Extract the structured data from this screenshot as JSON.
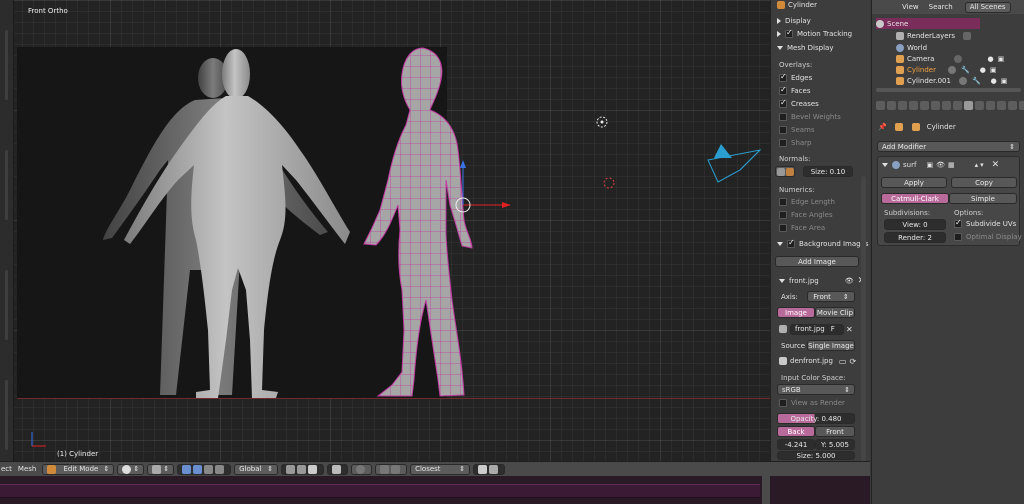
{
  "viewport": {
    "view_label": "Front Ortho",
    "active_object_label": "(1) Cylinder"
  },
  "npanel": {
    "object_field": "Cylinder",
    "display": "Display",
    "motion_tracking": "Motion Tracking",
    "mesh_display": "Mesh Display",
    "overlays": "Overlays:",
    "edges": "Edges",
    "faces": "Faces",
    "creases": "Creases",
    "bevel_weights": "Bevel Weights",
    "seams": "Seams",
    "sharp": "Sharp",
    "normals": "Normals:",
    "normal_size": "Size: 0.10",
    "numerics": "Numerics:",
    "edge_length": "Edge Length",
    "face_angles": "Face Angles",
    "face_area": "Face Area",
    "background_images": "Background Images",
    "add_image": "Add Image",
    "bg_file": "front.jpg",
    "axis_label": "Axis:",
    "axis_value": "Front",
    "image_tab": "Image",
    "movie_clip_tab": "Movie Clip",
    "image_name": "front.jpg",
    "image_users": "F",
    "source_label": "Source",
    "source_value": "Single Image",
    "filepath": "denfront.jpg",
    "color_space_label": "Input Color Space:",
    "color_space_value": "sRGB",
    "view_as_render": "View as Render",
    "opacity": "Opacity: 0.480",
    "back": "Back",
    "front": "Front",
    "x_offset": "-4.241",
    "y_offset": "Y: 5.005",
    "size": "Size: 5.000"
  },
  "outliner": {
    "view": "View",
    "search": "Search",
    "all_scenes": "All Scenes",
    "items": [
      "Scene",
      "RenderLayers",
      "World",
      "Camera",
      "Cylinder",
      "Cylinder.001"
    ]
  },
  "properties": {
    "object_name": "Cylinder",
    "add_modifier": "Add Modifier",
    "modifier_name": "surf",
    "apply": "Apply",
    "copy": "Copy",
    "catmull_clark": "Catmull-Clark",
    "simple": "Simple",
    "subdivisions": "Subdivisions:",
    "options": "Options:",
    "view_levels": "View: 0",
    "render_levels": "Render: 2",
    "subdivide_uvs": "Subdivide UVs",
    "optimal_display": "Optimal Display"
  },
  "header": {
    "select": "ect",
    "mesh": "Mesh",
    "mode": "Edit Mode",
    "orientation": "Global",
    "snap": "Closest"
  },
  "colors": {
    "accent_pink": "#b86a9a",
    "selection_magenta": "#c040a0",
    "camera_cyan": "#2a9ed0",
    "axis_red": "#e02020"
  }
}
